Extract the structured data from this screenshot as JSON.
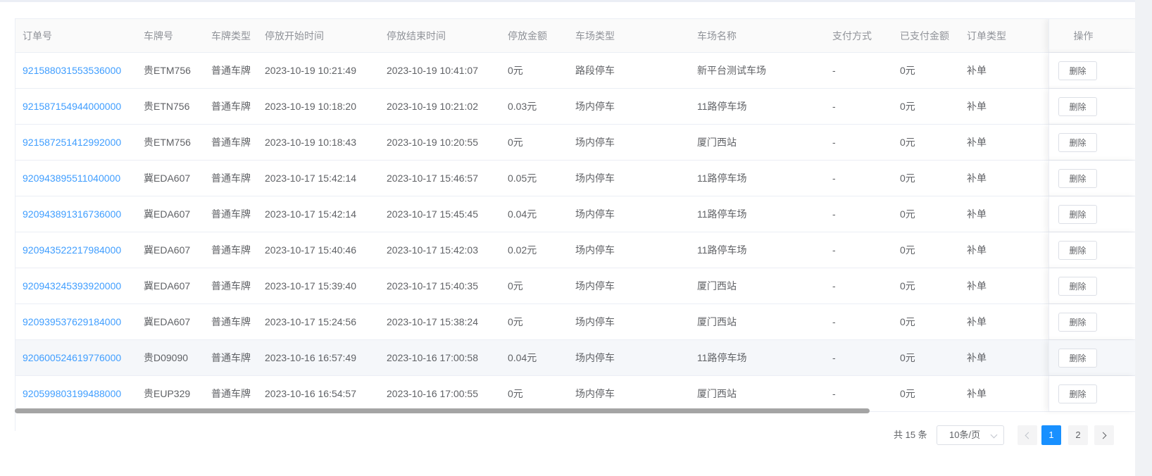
{
  "table": {
    "columns": [
      "订单号",
      "车牌号",
      "车牌类型",
      "停放开始时间",
      "停放结束时间",
      "停放金额",
      "车场类型",
      "车场名称",
      "支付方式",
      "已支付金额",
      "订单类型"
    ],
    "op_header": "操作",
    "delete_label": "删除",
    "rows": [
      {
        "order_no": "921588031553536000",
        "plate": "贵ETM756",
        "plate_type": "普通车牌",
        "start": "2023-10-19 10:21:49",
        "end": "2023-10-19 10:41:07",
        "amount": "0元",
        "lot_type": "路段停车",
        "lot_name": "新平台测试车场",
        "pay_method": "-",
        "paid": "0元",
        "order_type": "补单"
      },
      {
        "order_no": "921587154944000000",
        "plate": "贵ETN756",
        "plate_type": "普通车牌",
        "start": "2023-10-19 10:18:20",
        "end": "2023-10-19 10:21:02",
        "amount": "0.03元",
        "lot_type": "场内停车",
        "lot_name": "11路停车场",
        "pay_method": "-",
        "paid": "0元",
        "order_type": "补单"
      },
      {
        "order_no": "921587251412992000",
        "plate": "贵ETM756",
        "plate_type": "普通车牌",
        "start": "2023-10-19 10:18:43",
        "end": "2023-10-19 10:20:55",
        "amount": "0元",
        "lot_type": "场内停车",
        "lot_name": "厦门西站",
        "pay_method": "-",
        "paid": "0元",
        "order_type": "补单"
      },
      {
        "order_no": "920943895511040000",
        "plate": "冀EDA607",
        "plate_type": "普通车牌",
        "start": "2023-10-17 15:42:14",
        "end": "2023-10-17 15:46:57",
        "amount": "0.05元",
        "lot_type": "场内停车",
        "lot_name": "11路停车场",
        "pay_method": "-",
        "paid": "0元",
        "order_type": "补单"
      },
      {
        "order_no": "920943891316736000",
        "plate": "冀EDA607",
        "plate_type": "普通车牌",
        "start": "2023-10-17 15:42:14",
        "end": "2023-10-17 15:45:45",
        "amount": "0.04元",
        "lot_type": "场内停车",
        "lot_name": "11路停车场",
        "pay_method": "-",
        "paid": "0元",
        "order_type": "补单"
      },
      {
        "order_no": "920943522217984000",
        "plate": "冀EDA607",
        "plate_type": "普通车牌",
        "start": "2023-10-17 15:40:46",
        "end": "2023-10-17 15:42:03",
        "amount": "0.02元",
        "lot_type": "场内停车",
        "lot_name": "11路停车场",
        "pay_method": "-",
        "paid": "0元",
        "order_type": "补单"
      },
      {
        "order_no": "920943245393920000",
        "plate": "冀EDA607",
        "plate_type": "普通车牌",
        "start": "2023-10-17 15:39:40",
        "end": "2023-10-17 15:40:35",
        "amount": "0元",
        "lot_type": "场内停车",
        "lot_name": "厦门西站",
        "pay_method": "-",
        "paid": "0元",
        "order_type": "补单"
      },
      {
        "order_no": "920939537629184000",
        "plate": "冀EDA607",
        "plate_type": "普通车牌",
        "start": "2023-10-17 15:24:56",
        "end": "2023-10-17 15:38:24",
        "amount": "0元",
        "lot_type": "场内停车",
        "lot_name": "厦门西站",
        "pay_method": "-",
        "paid": "0元",
        "order_type": "补单"
      },
      {
        "order_no": "920600524619776000",
        "plate": "贵D09090",
        "plate_type": "普通车牌",
        "start": "2023-10-16 16:57:49",
        "end": "2023-10-16 17:00:58",
        "amount": "0.04元",
        "lot_type": "场内停车",
        "lot_name": "11路停车场",
        "pay_method": "-",
        "paid": "0元",
        "order_type": "补单"
      },
      {
        "order_no": "920599803199488000",
        "plate": "贵EUP329",
        "plate_type": "普通车牌",
        "start": "2023-10-16 16:54:57",
        "end": "2023-10-16 17:00:55",
        "amount": "0元",
        "lot_type": "场内停车",
        "lot_name": "厦门西站",
        "pay_method": "-",
        "paid": "0元",
        "order_type": "补单"
      }
    ]
  },
  "pagination": {
    "total_text": "共 15 条",
    "page_size": "10条/页",
    "pages": [
      "1",
      "2"
    ],
    "current_page": "1"
  },
  "colors": {
    "link": "#409eff",
    "active_page": "#1890ff"
  }
}
